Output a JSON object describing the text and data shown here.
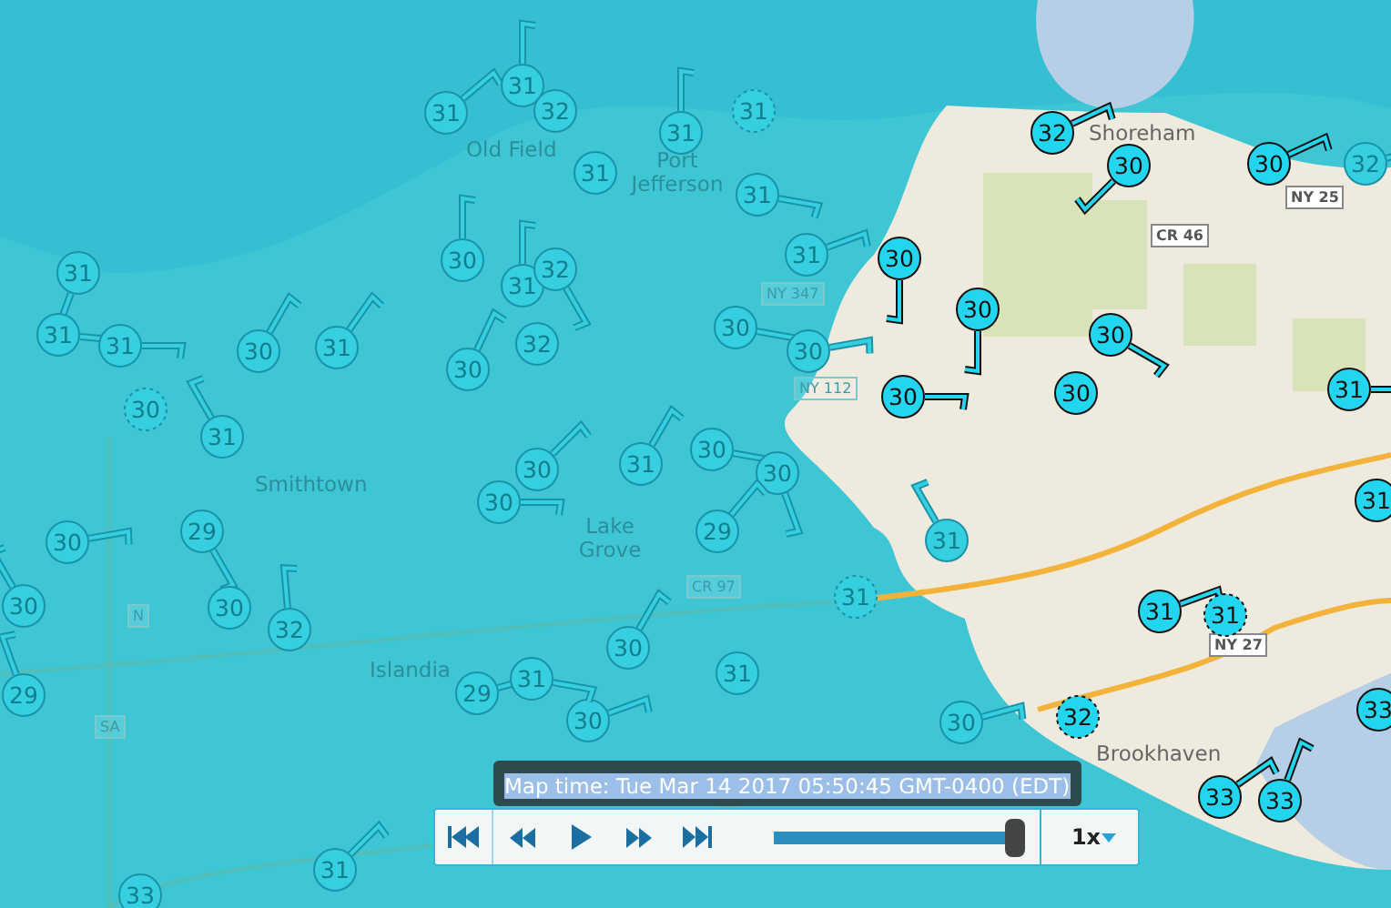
{
  "map": {
    "places": [
      {
        "name": "Old Field"
      },
      {
        "name": "Port Jefferson"
      },
      {
        "name": "Smithtown"
      },
      {
        "name": "Lake Grove"
      },
      {
        "name": "Islandia"
      },
      {
        "name": "Brookhaven"
      },
      {
        "name": "Shoreham"
      }
    ],
    "shields": [
      {
        "label": "NY 347"
      },
      {
        "label": "NY 112"
      },
      {
        "label": "CR 46"
      },
      {
        "label": "NY 25"
      },
      {
        "label": "CR 97"
      },
      {
        "label": "N"
      },
      {
        "label": "SA"
      },
      {
        "label": "NY 27"
      }
    ],
    "stations": [
      {
        "temp": "31",
        "dashed": false,
        "emphasis": false
      },
      {
        "temp": "31",
        "dashed": false,
        "emphasis": false
      },
      {
        "temp": "32",
        "dashed": false,
        "emphasis": false
      },
      {
        "temp": "31",
        "dashed": false,
        "emphasis": false
      },
      {
        "temp": "31",
        "dashed": true,
        "emphasis": false
      },
      {
        "temp": "31",
        "dashed": false,
        "emphasis": false
      },
      {
        "temp": "31",
        "dashed": false,
        "emphasis": false
      },
      {
        "temp": "30",
        "dashed": false,
        "emphasis": false
      },
      {
        "temp": "31",
        "dashed": false,
        "emphasis": false
      },
      {
        "temp": "32",
        "dashed": false,
        "emphasis": false
      },
      {
        "temp": "32",
        "dashed": false,
        "emphasis": false
      },
      {
        "temp": "30",
        "dashed": false,
        "emphasis": false
      },
      {
        "temp": "31",
        "dashed": false,
        "emphasis": false
      },
      {
        "temp": "31",
        "dashed": false,
        "emphasis": false
      },
      {
        "temp": "31",
        "dashed": false,
        "emphasis": false
      },
      {
        "temp": "30",
        "dashed": false,
        "emphasis": false
      },
      {
        "temp": "31",
        "dashed": false,
        "emphasis": false
      },
      {
        "temp": "30",
        "dashed": true,
        "emphasis": false
      },
      {
        "temp": "31",
        "dashed": false,
        "emphasis": false
      },
      {
        "temp": "32",
        "dashed": false,
        "emphasis": true
      },
      {
        "temp": "30",
        "dashed": false,
        "emphasis": true
      },
      {
        "temp": "30",
        "dashed": false,
        "emphasis": true
      },
      {
        "temp": "32",
        "dashed": false,
        "emphasis": false
      },
      {
        "temp": "31",
        "dashed": false,
        "emphasis": false
      },
      {
        "temp": "30",
        "dashed": false,
        "emphasis": true
      },
      {
        "temp": "30",
        "dashed": false,
        "emphasis": true
      },
      {
        "temp": "30",
        "dashed": false,
        "emphasis": true
      },
      {
        "temp": "30",
        "dashed": false,
        "emphasis": true
      },
      {
        "temp": "30",
        "dashed": false,
        "emphasis": false
      },
      {
        "temp": "30",
        "dashed": false,
        "emphasis": false
      },
      {
        "temp": "30",
        "dashed": false,
        "emphasis": true
      },
      {
        "temp": "31",
        "dashed": false,
        "emphasis": true
      },
      {
        "temp": "30",
        "dashed": false,
        "emphasis": false
      },
      {
        "temp": "30",
        "dashed": false,
        "emphasis": false
      },
      {
        "temp": "30",
        "dashed": false,
        "emphasis": false
      },
      {
        "temp": "30",
        "dashed": false,
        "emphasis": false
      },
      {
        "temp": "31",
        "dashed": false,
        "emphasis": false
      },
      {
        "temp": "30",
        "dashed": false,
        "emphasis": false
      },
      {
        "temp": "29",
        "dashed": false,
        "emphasis": false
      },
      {
        "temp": "30",
        "dashed": false,
        "emphasis": false
      },
      {
        "temp": "32",
        "dashed": false,
        "emphasis": false
      },
      {
        "temp": "30",
        "dashed": false,
        "emphasis": false
      },
      {
        "temp": "29",
        "dashed": false,
        "emphasis": false
      },
      {
        "temp": "29",
        "dashed": false,
        "emphasis": false
      },
      {
        "temp": "31",
        "dashed": false,
        "emphasis": false
      },
      {
        "temp": "30",
        "dashed": false,
        "emphasis": false
      },
      {
        "temp": "30",
        "dashed": false,
        "emphasis": false
      },
      {
        "temp": "31",
        "dashed": false,
        "emphasis": false
      },
      {
        "temp": "33",
        "dashed": false,
        "emphasis": false
      },
      {
        "temp": "29",
        "dashed": false,
        "emphasis": false
      },
      {
        "temp": "31",
        "dashed": false,
        "emphasis": false
      },
      {
        "temp": "31",
        "dashed": true,
        "emphasis": false
      },
      {
        "temp": "31",
        "dashed": false,
        "emphasis": false
      },
      {
        "temp": "30",
        "dashed": false,
        "emphasis": false
      },
      {
        "temp": "32",
        "dashed": true,
        "emphasis": true
      },
      {
        "temp": "31",
        "dashed": false,
        "emphasis": true
      },
      {
        "temp": "31",
        "dashed": true,
        "emphasis": true
      },
      {
        "temp": "33",
        "dashed": false,
        "emphasis": true
      },
      {
        "temp": "33",
        "dashed": false,
        "emphasis": true
      },
      {
        "temp": "31",
        "dashed": false,
        "emphasis": true
      },
      {
        "temp": "33",
        "dashed": false,
        "emphasis": true
      }
    ]
  },
  "playback": {
    "map_time": "Map time: Tue Mar 14 2017 05:50:45 GMT-0400 (EDT)",
    "slider": {
      "level": 1
    },
    "speed": "1x"
  }
}
